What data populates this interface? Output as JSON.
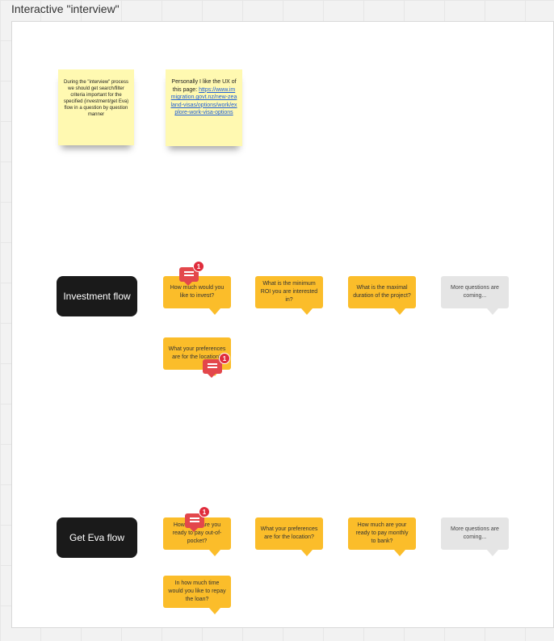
{
  "board": {
    "frame_title": "Interactive \"interview\""
  },
  "stickies": [
    {
      "text": "During the \"interview\" process we should get search/filter criteria important for the specified (investment/get Eva) flow in a question by question manner"
    },
    {
      "text_prefix": "Personally I like the UX of this page: ",
      "link_text": "https://www.immigration.govt.nz/new-zealand-visas/options/work/explore-work-visa-options"
    }
  ],
  "flows": {
    "investment": {
      "label": "Investment flow",
      "questions": [
        "How much would you like to invest?",
        "What is the minimum ROI you are interested in?",
        "What is the maximal duration of the project?",
        "More questions are coming...",
        "What your preferences are for the location?"
      ]
    },
    "get_eva": {
      "label": "Get Eva flow",
      "questions": [
        "How much are you ready to pay out-of-pocket?",
        "What your preferences are for the location?",
        "How much are your ready to pay monthly to bank?",
        "More questions are coming...",
        "In how much time would you like to repay the loan?"
      ]
    }
  },
  "comments": [
    {
      "count": "1"
    },
    {
      "count": "1"
    },
    {
      "count": "1"
    }
  ],
  "colors": {
    "sticky": "#fff9b1",
    "question_bubble": "#fbbd2a",
    "placeholder_bubble": "#e5e5e5",
    "flow_label": "#1a1a1a",
    "comment_badge": "#e02d3c"
  }
}
